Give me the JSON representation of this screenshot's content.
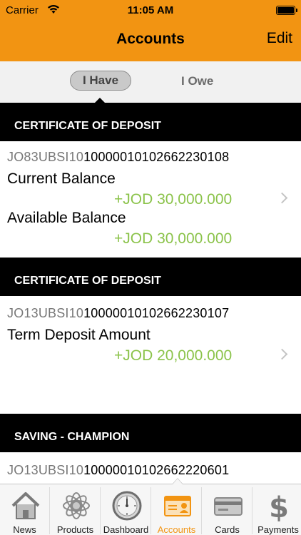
{
  "status_bar": {
    "carrier": "Carrier",
    "time": "11:05 AM"
  },
  "nav": {
    "title": "Accounts",
    "edit_label": "Edit"
  },
  "segment": {
    "options": [
      "I Have",
      "I Owe"
    ],
    "selected": "I Have"
  },
  "accounts": [
    {
      "type": "CERTIFICATE OF DEPOSIT",
      "account_prefix": "JO83UBSI10",
      "account_rest": "1000001010266223010​8",
      "rows": [
        {
          "label": "Current Balance",
          "amount": "+JOD 30,000.000"
        },
        {
          "label": "Available Balance",
          "amount": "+JOD 30,000.000"
        }
      ]
    },
    {
      "type": "CERTIFICATE OF DEPOSIT",
      "account_prefix": "JO13UBSI10",
      "account_rest": "10000010102662230107",
      "rows": [
        {
          "label": "Term Deposit Amount",
          "amount": "+JOD 20,000.000"
        }
      ]
    },
    {
      "type": "SAVING - CHAMPION",
      "account_prefix": "JO13UBSI10",
      "account_rest": "10000010102662220601",
      "rows": []
    }
  ],
  "tabbar": {
    "items": [
      {
        "label": "News",
        "icon": "house-icon"
      },
      {
        "label": "Products",
        "icon": "flower-icon"
      },
      {
        "label": "Dashboard",
        "icon": "gauge-icon"
      },
      {
        "label": "Accounts",
        "icon": "id-card-icon"
      },
      {
        "label": "Cards",
        "icon": "credit-card-icon"
      },
      {
        "label": "Payments",
        "icon": "dollar-icon"
      }
    ],
    "active": "Accounts"
  },
  "colors": {
    "accent": "#f29412",
    "amount": "#8bc34a",
    "section_bg": "#000000"
  }
}
